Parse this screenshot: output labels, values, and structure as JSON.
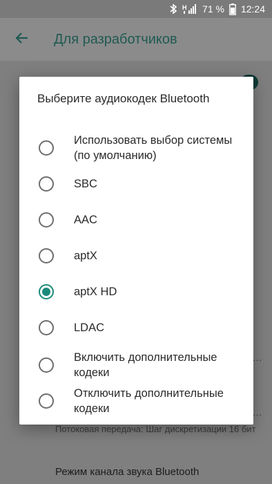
{
  "status_bar": {
    "battery": "71 %",
    "time": "12:24"
  },
  "app_bar": {
    "title": "Для разработчиков"
  },
  "background": {
    "subtitle": "Потоковая передача: Шаг дискретизации 16 бит",
    "item_title": "Режим канала звука Bluetooth",
    "overflow_marker": "..."
  },
  "dialog": {
    "title": "Выберите аудиокодек Bluetooth",
    "options": [
      {
        "label": "Использовать выбор системы (по умолчанию)",
        "checked": false
      },
      {
        "label": "SBC",
        "checked": false
      },
      {
        "label": "AAC",
        "checked": false
      },
      {
        "label": "aptX",
        "checked": false
      },
      {
        "label": "aptX HD",
        "checked": true
      },
      {
        "label": "LDAC",
        "checked": false
      },
      {
        "label": "Включить дополнительные кодеки",
        "checked": false
      },
      {
        "label": "Отключить дополнительные кодеки",
        "checked": false
      }
    ],
    "accent_color": "#1b8a7a"
  }
}
